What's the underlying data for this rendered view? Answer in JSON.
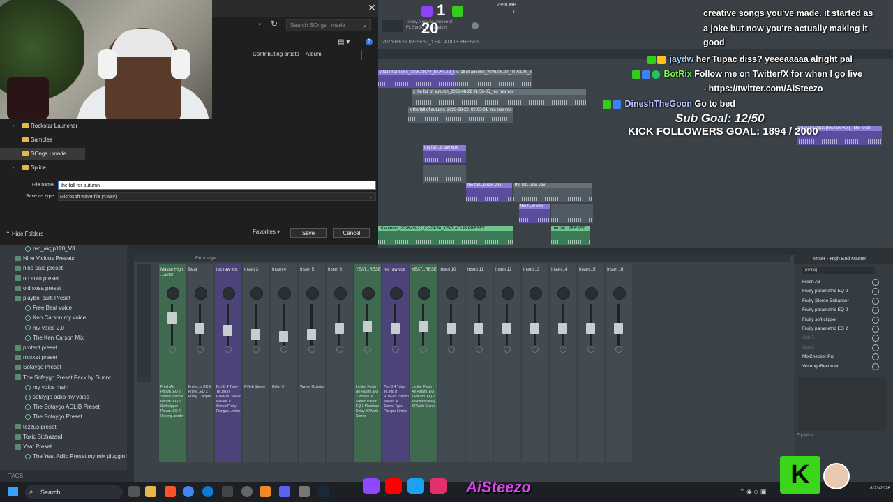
{
  "dialog": {
    "search_placeholder": "Search SOngs I made",
    "columns": [
      "Contributing artists",
      "Album"
    ],
    "folders": [
      {
        "label": "Rockstar Launcher",
        "arrow": true
      },
      {
        "label": "Samples",
        "arrow": false
      },
      {
        "label": "SOngs I made",
        "arrow": false,
        "selected": true
      },
      {
        "label": "Splice",
        "arrow": true
      }
    ],
    "file_name_label": "File name:",
    "file_name_value": "the fall for autumn",
    "save_type_label": "Save as type:",
    "save_type_value": "Microsoft wave file (*.wav)",
    "hide_folders": "Hide Folders",
    "favorites": "Favorites",
    "save": "Save",
    "cancel": "Cancel"
  },
  "fl": {
    "twitch_count": "1",
    "kick_count": "20",
    "cpu_top": "2398 MB",
    "cpu_bottom": "0",
    "hint_line1": "Today  A newer version of",
    "hint_line2": "FL Studio is available!",
    "playlist_title": "2026-08-22 02-29-50_YEAT ADLIB PRESET",
    "clips": {
      "c1": "x fall of autumn_2026-08-22_01-53-19_rec raw vox",
      "c2": "x the fall of autumn_2026-08-22 01-56-05_rec raw vox",
      "c3": "x the fall of autumn_2026-08-22_02-03-01_rec raw vox",
      "c4": "the fall...c raw vox",
      "c5": "the fall...o raw vox",
      "c6": "the fall...raw vox",
      "c7": "the f...w vox",
      "c8": "of autumn_2026-08-22_02-29-50_YEAT ADLIB PRESET",
      "c9": "the fall...PRESET",
      "c10": "Fruity Flangus (rec raw vox) - Mix level"
    }
  },
  "chat": {
    "intro_line1": "creative songs you've made. it started as",
    "intro_line2": "a joke but now you're actually making it",
    "intro_line3": "good",
    "m1_user": "jaydw",
    "m1_text": "her Tupac diss? yeeeaaaaa alright pal",
    "m2_user": "BotRix",
    "m2_text": "Follow me on Twitter/X for when I go live",
    "m2_text2": "- https://twitter.com/AiSteezo",
    "m3_user": "DineshTheGoon",
    "m3_text": "Go to bed",
    "sub_goal": "Sub Goal: 12/50",
    "kick_goal": "KICK FOLLOWERS GOAL: 1894 / 2000"
  },
  "browser": {
    "items": [
      {
        "label": "rec_akgp120_V3",
        "kind": "preset"
      },
      {
        "label": "Nine Vicious Presets",
        "kind": "folder"
      },
      {
        "label": "nino paid preset",
        "kind": "folder"
      },
      {
        "label": "no auto preset",
        "kind": "folder"
      },
      {
        "label": "old sosa preset",
        "kind": "folder"
      },
      {
        "label": "playboi carti Preset",
        "kind": "folder"
      },
      {
        "label": "Free Beat voice",
        "kind": "preset"
      },
      {
        "label": "Ken Carson my voice",
        "kind": "preset"
      },
      {
        "label": "my voice 2.0",
        "kind": "preset"
      },
      {
        "label": "The Ken Carson Mix",
        "kind": "preset"
      },
      {
        "label": "protect preset",
        "kind": "folder"
      },
      {
        "label": "rroxket preset",
        "kind": "folder"
      },
      {
        "label": "Sofaygo Preset",
        "kind": "folder"
      },
      {
        "label": "The Sofaygo Preset Pack by Gunnr",
        "kind": "folder"
      },
      {
        "label": "my voice main",
        "kind": "preset"
      },
      {
        "label": "sofaygo adlib my voice",
        "kind": "preset"
      },
      {
        "label": "The Sofaygo ADLIB Preset",
        "kind": "preset"
      },
      {
        "label": "The Sofaygo Preset",
        "kind": "preset"
      },
      {
        "label": "tezzus preset",
        "kind": "folder"
      },
      {
        "label": "Toxic Biohazard",
        "kind": "folder"
      },
      {
        "label": "Yeat Preset",
        "kind": "folder"
      },
      {
        "label": "The Yeat Adlib Preset my mix pluggin b",
        "kind": "preset"
      }
    ],
    "footer": "TAGS"
  },
  "mixer": {
    "header": "Extra large",
    "strips": [
      {
        "name": "Master High ...aster",
        "fx": "Fresh Air Param. EQ 2 Stereo..hancer Param. EQ 2 Soft clipper Param. EQ 2 Voxeng..corder"
      },
      {
        "name": "Beat",
        "fx": "Fruity...ic EQ 2 Fruity...EQ 2 Fruity...Clipper"
      },
      {
        "name": "rec raw vox",
        "fx": "Pro-Q 4 Tube-Te..mk II RDeEss..Stereo Waves..e Stereo Fruity Flangus Limiter"
      },
      {
        "name": "Insert 3",
        "fx": "RVerb Stereo"
      },
      {
        "name": "Insert 4",
        "fx": "Delay 3"
      },
      {
        "name": "Insert 5",
        "fx": "Waves H..tereo"
      },
      {
        "name": "Insert 6",
        "fx": ""
      },
      {
        "name": "YEAT...RESET",
        "fx": "Limiter Fresh Air Param. EQ 2 Waves..e Stereo Param. EQ 2 Maximus Delay 3 RVerb Stereo"
      },
      {
        "name": "rec raw vox",
        "fx": "Pro-Q 4 Tube-Te..mk II RDeEss..Stereo Waves..e Stereo Tape Flangus Limiter"
      },
      {
        "name": "YEAT...RESET",
        "fx": "Limiter Fresh Air Param. EQ 2 Param. EQ 2 Maximus Delay 3 RVerb Stereo"
      },
      {
        "name": "Insert 10",
        "fx": ""
      },
      {
        "name": "Insert 11",
        "fx": ""
      },
      {
        "name": "Insert 12",
        "fx": ""
      },
      {
        "name": "Insert 13",
        "fx": ""
      },
      {
        "name": "Insert 14",
        "fx": ""
      },
      {
        "name": "Insert 15",
        "fx": ""
      },
      {
        "name": "Insert 16",
        "fx": ""
      }
    ]
  },
  "fxpanel": {
    "title": "Mixer - High End Master",
    "input": "(none)",
    "slots": [
      "Fresh Air",
      "Fruity parametric EQ 2",
      "Fruity Stereo Enhancer",
      "Fruity parametric EQ 2",
      "Fruity soft clipper",
      "Fruity parametric EQ 2",
      "Slot 7",
      "Slot 8",
      "MixChecker Pro",
      "VoxengoRecorder"
    ],
    "equalizer": "Equalizer"
  },
  "taskbar": {
    "search": "Search",
    "time": "",
    "date": "8/23/2026",
    "handle": "AiSteezo"
  },
  "colors": {
    "accent_purple": "#8b7ad6",
    "accent_green": "#6fc48c",
    "kick_green": "#3bd61c",
    "twitch_purple": "#8b44f7"
  }
}
